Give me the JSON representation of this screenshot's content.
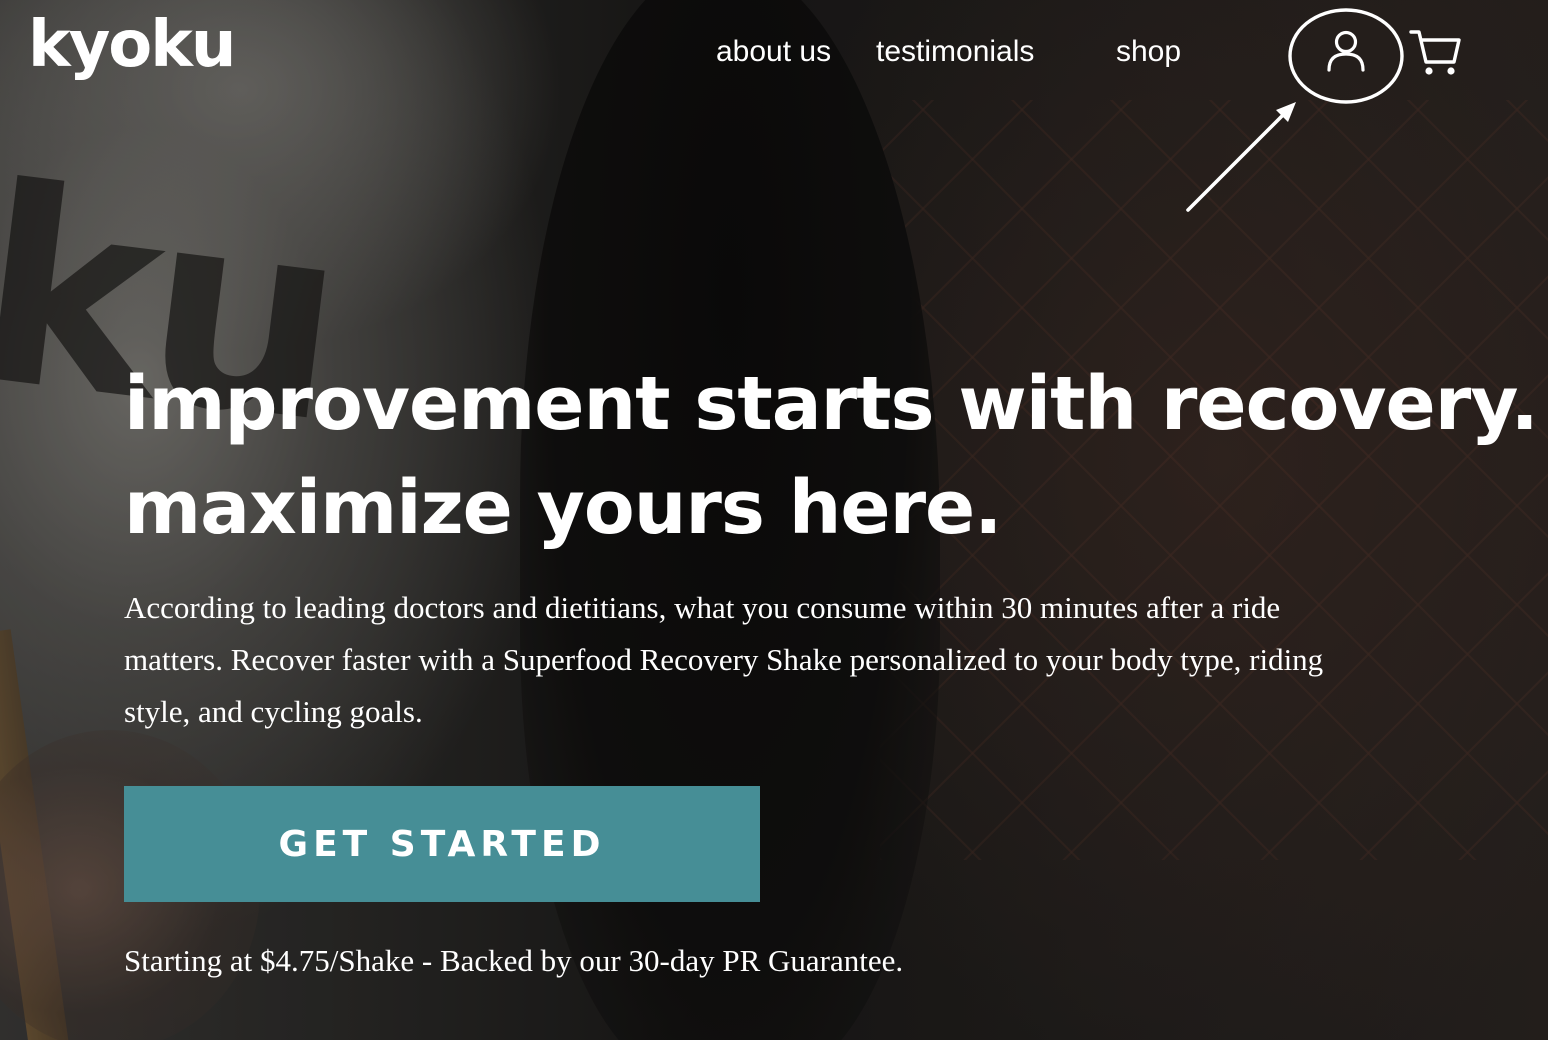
{
  "header": {
    "logo_text": "kyoku",
    "nav": {
      "about": "about us",
      "testimonials": "testimonials",
      "shop": "shop"
    },
    "account_icon": "user-icon",
    "cart_icon": "cart-icon"
  },
  "hero": {
    "headline_line1": "improvement starts with recovery.",
    "headline_line2": "maximize yours here.",
    "body": "According to leading doctors and dietitians, what you consume within 30 minutes after a ride matters. Recover faster with a Superfood Recovery Shake personalized to your body type, riding style, and cycling goals.",
    "cta_label": "GET STARTED",
    "pricing": "Starting at $4.75/Shake - Backed by our 30-day PR Guarantee.",
    "background_shirt_text": "ku"
  },
  "colors": {
    "cta_background": "#468e96",
    "text": "#ffffff"
  }
}
